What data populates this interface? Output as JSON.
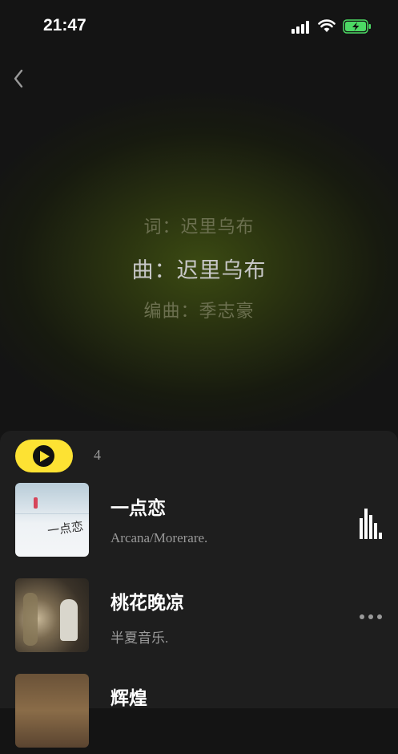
{
  "status_bar": {
    "time": "21:47"
  },
  "credits": [
    {
      "text": "词：迟里乌布",
      "active": false
    },
    {
      "text": "曲：迟里乌布",
      "active": true
    },
    {
      "text": "编曲：季志豪",
      "active": false
    }
  ],
  "playlist": {
    "count": "4",
    "songs": [
      {
        "title": "一点恋",
        "artist": "Arcana/Morerare.",
        "cover_text": "一点恋",
        "state": "playing"
      },
      {
        "title": "桃花晚凉",
        "artist": "半夏音乐.",
        "state": "more"
      },
      {
        "title": "辉煌",
        "artist": "",
        "state": ""
      }
    ]
  },
  "colors": {
    "accent": "#fde233",
    "background": "#141414",
    "sheet": "#1e1e1e"
  }
}
